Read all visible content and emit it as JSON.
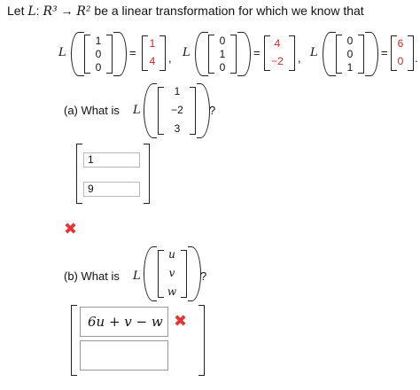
{
  "header": {
    "prefix": "Let",
    "map_name": "L",
    "domain": "R³",
    "arrow": "→",
    "codomain": "R²",
    "suffix": "be a linear transformation for which we know that"
  },
  "given": [
    {
      "input": [
        "1",
        "0",
        "0"
      ],
      "output": [
        "1",
        "4"
      ]
    },
    {
      "input": [
        "0",
        "1",
        "0"
      ],
      "output": [
        "4",
        "−2"
      ]
    },
    {
      "input": [
        "0",
        "0",
        "1"
      ],
      "output": [
        "6",
        "0"
      ]
    }
  ],
  "labels": {
    "L": "L",
    "equals": "=",
    "comma": ",",
    "period": "."
  },
  "part_a": {
    "question": "(a) What is",
    "L": "L",
    "vector": [
      "1",
      "−2",
      "3"
    ],
    "qmark": "?",
    "answers": [
      "1",
      "9"
    ],
    "status_icon": "x-mark-icon",
    "status_color": "#e43434"
  },
  "part_b": {
    "question": "(b) What is",
    "L": "L",
    "vector": [
      "u",
      "v",
      "w"
    ],
    "qmark": "?",
    "answers": [
      "6u + v − w",
      ""
    ],
    "status_icon": "x-mark-icon",
    "status_color": "#e43434"
  },
  "colors": {
    "given_output": "#d22222",
    "error": "#e43434"
  }
}
